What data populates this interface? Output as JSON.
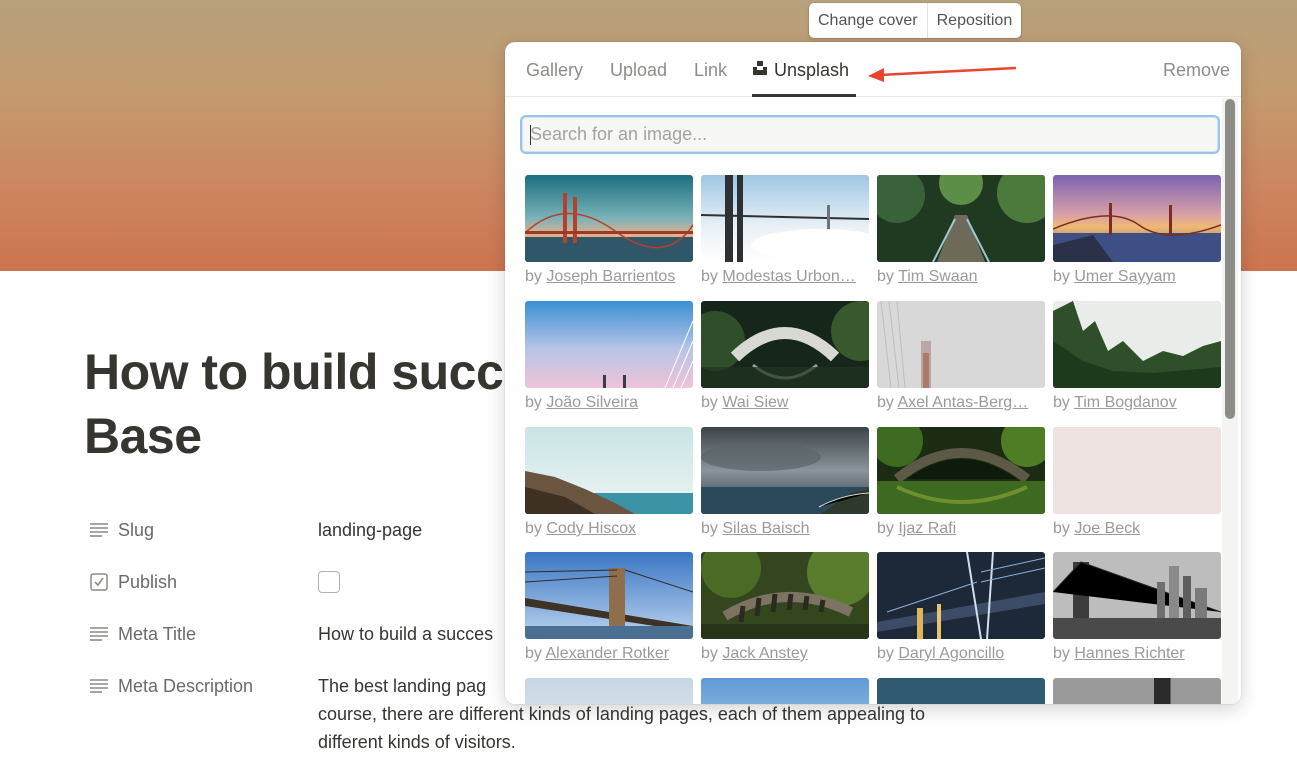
{
  "cover": {
    "actions": [
      "Change cover",
      "Reposition"
    ]
  },
  "page": {
    "title": "How to build succe… Base",
    "title_line1": "How to build succe",
    "title_line2": "Base",
    "properties": [
      {
        "label": "Slug",
        "icon": "lines-icon",
        "value": "landing-page"
      },
      {
        "label": "Publish",
        "icon": "checkbox-icon",
        "value": ""
      },
      {
        "label": "Meta Title",
        "icon": "lines-icon",
        "value": "How to build a succes"
      },
      {
        "label": "Meta Description",
        "icon": "lines-icon",
        "value_line1": "The best landing pag",
        "value_line2": "course, there are different kinds of landing pages, each of them appealing to",
        "value_line3": "different kinds of visitors."
      }
    ]
  },
  "popup": {
    "tabs": [
      "Gallery",
      "Upload",
      "Link",
      "Unsplash"
    ],
    "active_tab": "Unsplash",
    "remove_label": "Remove",
    "search_placeholder": "Search for an image...",
    "by_prefix": "by",
    "images": [
      {
        "author": "Joseph Barrientos",
        "theme": "golden-gate-teal"
      },
      {
        "author": "Modestas Urbon…",
        "theme": "bridge-fog"
      },
      {
        "author": "Tim Swaan",
        "theme": "forest-bridge"
      },
      {
        "author": "Umer Sayyam",
        "theme": "golden-gate-sunset"
      },
      {
        "author": "João Silveira",
        "theme": "pink-sky"
      },
      {
        "author": "Wai Siew",
        "theme": "stone-bridge-garden"
      },
      {
        "author": "Axel Antas-Berg…",
        "theme": "fog-tower"
      },
      {
        "author": "Tim Bogdanov",
        "theme": "pine-forest"
      },
      {
        "author": "Cody Hiscox",
        "theme": "coast-cliff"
      },
      {
        "author": "Silas Baisch",
        "theme": "storm-sea"
      },
      {
        "author": "Ijaz Rafi",
        "theme": "green-arch"
      },
      {
        "author": "Joe Beck",
        "theme": "pale-pink"
      },
      {
        "author": "Alexander Rotker",
        "theme": "brooklyn-bridge"
      },
      {
        "author": "Jack Anstey",
        "theme": "viaduct"
      },
      {
        "author": "Daryl Agoncillo",
        "theme": "night-bridge"
      },
      {
        "author": "Hannes Richter",
        "theme": "bw-bridge"
      }
    ]
  },
  "colors": {
    "accent_arrow": "#e8452c",
    "search_focus": "#9ac3ea"
  }
}
